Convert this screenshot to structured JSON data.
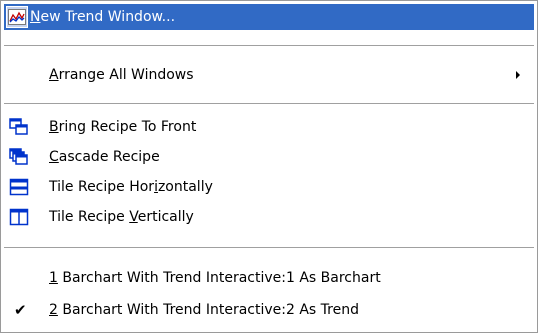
{
  "menu": {
    "items": [
      {
        "label": "New Trend Window...",
        "mnemonic_index": 0,
        "icon": "trend-chart-icon",
        "highlighted": true
      },
      {
        "label": "Arrange All Windows",
        "mnemonic_index": 0,
        "submenu": true
      },
      {
        "label": "Bring Recipe To Front",
        "mnemonic_index": 0,
        "icon": "bring-to-front-icon"
      },
      {
        "label": "Cascade Recipe",
        "mnemonic_index": 0,
        "icon": "cascade-icon"
      },
      {
        "label": "Tile Recipe Horizontally",
        "mnemonic_index": 15,
        "icon": "tile-horizontal-icon"
      },
      {
        "label": "Tile Recipe Vertically",
        "mnemonic_index": 12,
        "icon": "tile-vertical-icon"
      },
      {
        "label": "1 Barchart With Trend Interactive:1 As Barchart",
        "mnemonic_index": 0
      },
      {
        "label": "2 Barchart With Trend Interactive:2 As Trend",
        "mnemonic_index": 0,
        "checked": true
      }
    ]
  },
  "colors": {
    "highlight": "#316ac5",
    "icon_blue": "#0033cc",
    "separator": "#a0a0a0"
  }
}
